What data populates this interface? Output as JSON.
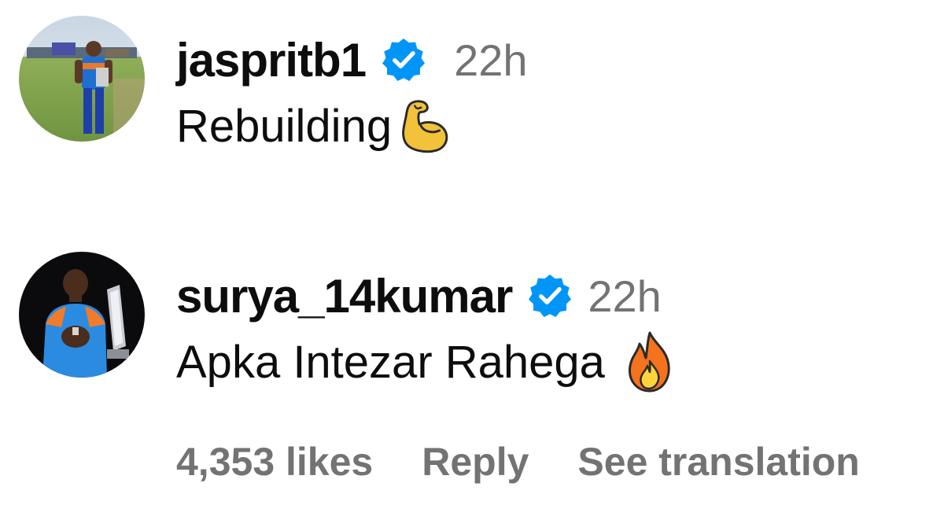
{
  "comments": [
    {
      "username": "jaspritb1",
      "verified": true,
      "time": "22h",
      "text": "Rebuilding",
      "emoji": "flexed-biceps-icon",
      "avatar": "profile-photo-cricketer-on-field"
    },
    {
      "username": "surya_14kumar",
      "verified": true,
      "time": "22h",
      "text": "Apka Intezar Rahega",
      "emoji": "fire-icon",
      "avatar": "profile-photo-cricketer-with-trophy",
      "actions": {
        "likes": "4,353 likes",
        "reply": "Reply",
        "see_translation": "See translation"
      }
    }
  ],
  "colors": {
    "verified_blue": "#0095f6",
    "secondary_text": "#737373",
    "primary_text": "#0d0d0d"
  }
}
